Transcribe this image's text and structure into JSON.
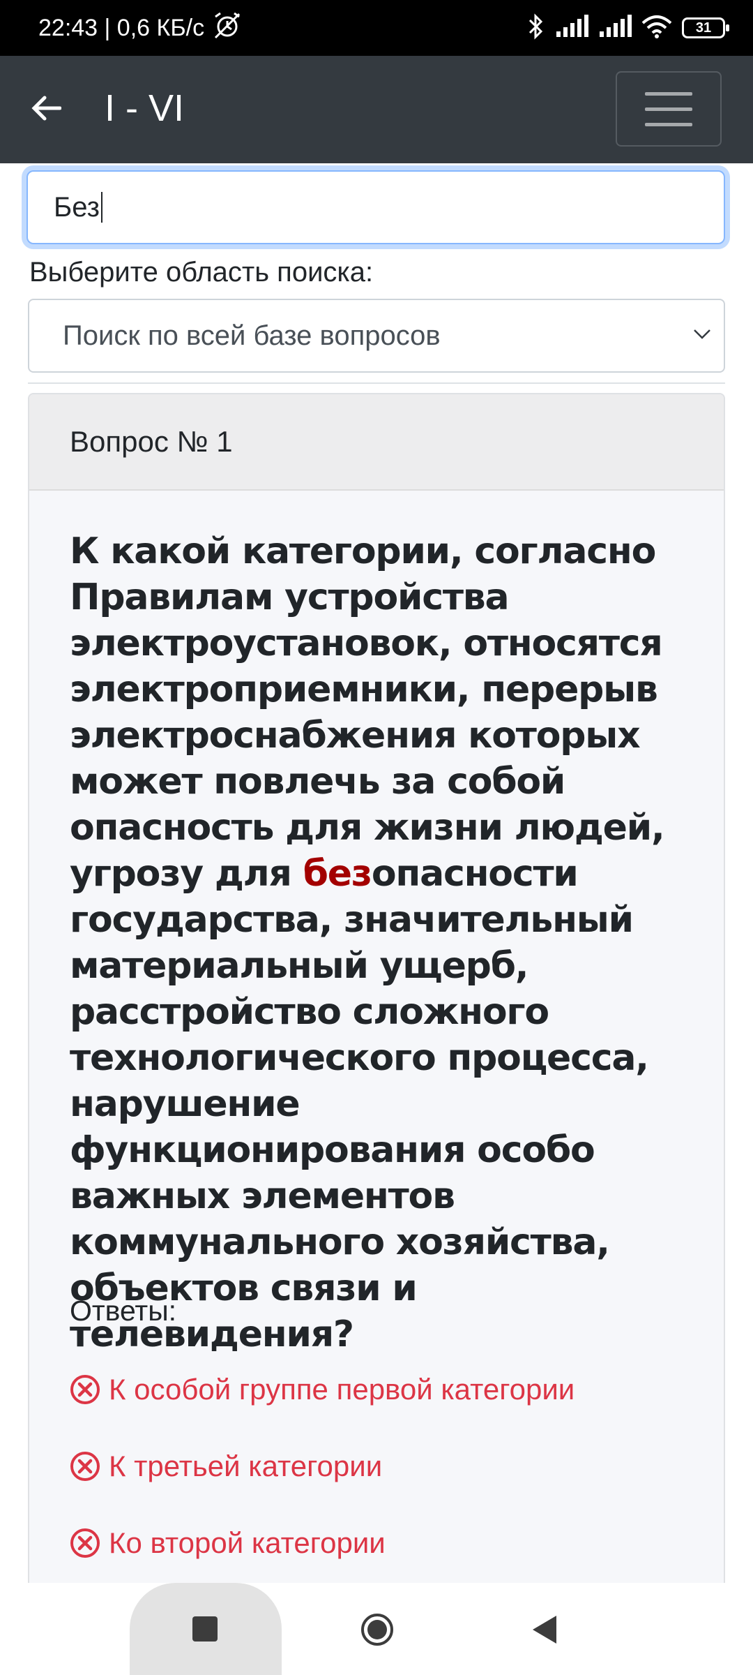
{
  "status": {
    "time_speed": "22:43 | 0,6 КБ/с",
    "battery": "31"
  },
  "appbar": {
    "title": "I - VI"
  },
  "search": {
    "value": "Без",
    "scope_label": "Выберите область поиска:",
    "scope_selected": "Поиск по всей базе вопросов"
  },
  "question": {
    "header": "Вопрос № 1",
    "text_before": "К какой категории, согласно Правилам устройства электроустановок, относятся электроприемники, перерыв электроснабжения которых может повлечь за собой опасность для жизни людей, угрозу для ",
    "text_highlight": "без",
    "text_after": "опасности государства, значительный материальный ущерб, расстройство сложного технологического процесса, нарушение функционирования особо важных элементов коммунального хозяйства, объектов связи и телевидения?",
    "answers_label": "Ответы:",
    "answers": [
      "К особой группе первой категории",
      "К третьей категории",
      "Ко второй категории"
    ]
  },
  "colors": {
    "appbar": "#343a40",
    "highlight": "#a30000",
    "wrong_answer": "#dc3545",
    "focus_border": "#86b7fe"
  }
}
